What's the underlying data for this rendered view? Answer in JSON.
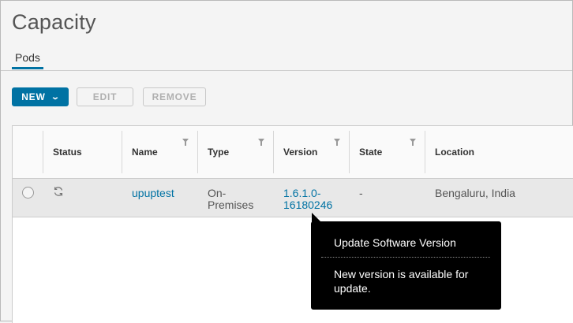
{
  "page": {
    "title": "Capacity"
  },
  "tabs": [
    {
      "label": "Pods",
      "active": true
    }
  ],
  "toolbar": {
    "new_label": "NEW",
    "edit_label": "EDIT",
    "remove_label": "REMOVE"
  },
  "grid": {
    "columns": [
      {
        "label": "",
        "filterable": false
      },
      {
        "label": "Status",
        "filterable": false
      },
      {
        "label": "Name",
        "filterable": true
      },
      {
        "label": "Type",
        "filterable": true
      },
      {
        "label": "Version",
        "filterable": true
      },
      {
        "label": "State",
        "filterable": true
      },
      {
        "label": "Location",
        "filterable": false
      }
    ],
    "rows": [
      {
        "status_icon": "sync-icon",
        "name": "upuptest",
        "type_line1": "On-",
        "type_line2": "Premises",
        "version_line1": "1.6.1.0-",
        "version_line2": "16180246",
        "state": "-",
        "location": "Bengaluru, India"
      }
    ]
  },
  "tooltip": {
    "title": "Update Software Version",
    "body": "New version is available for update."
  },
  "colors": {
    "accent": "#0072a3",
    "tooltip_bg": "#000000"
  }
}
